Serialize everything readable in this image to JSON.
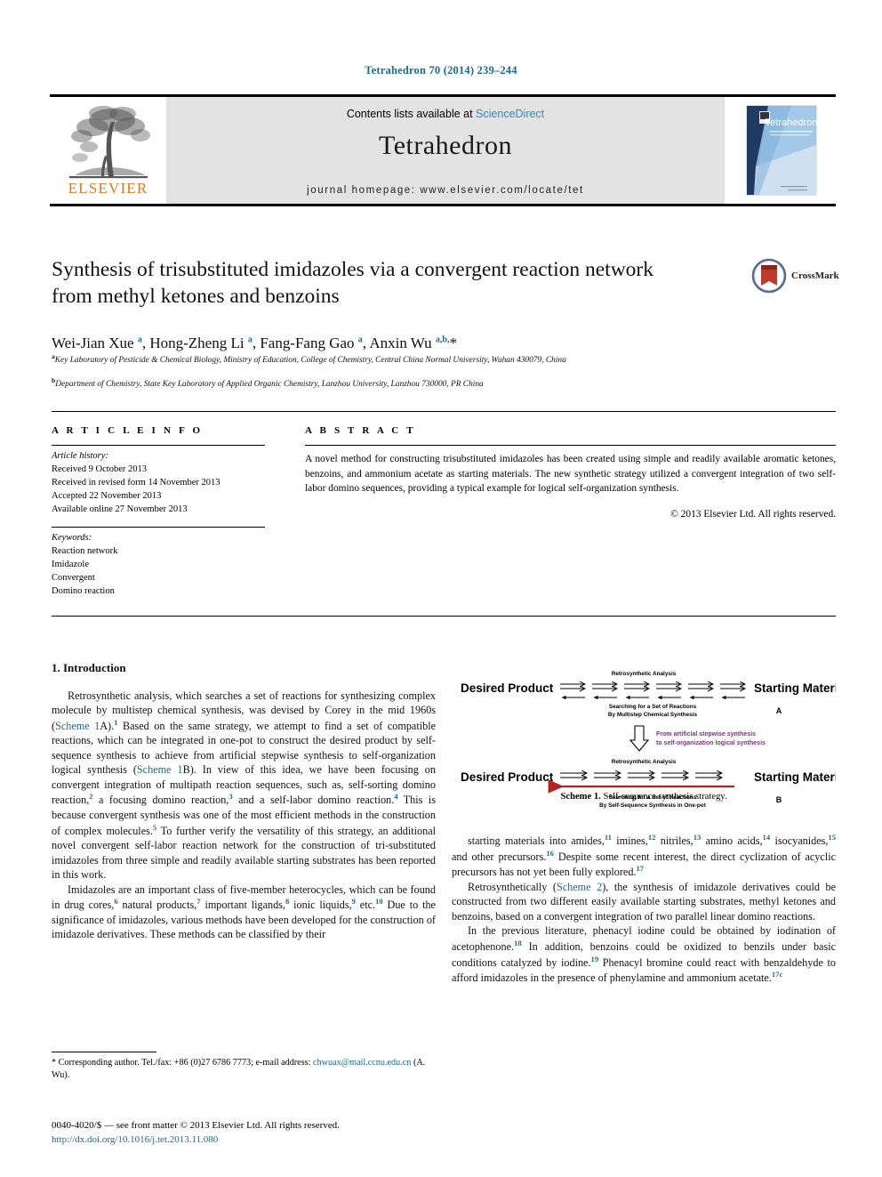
{
  "running_head": "Tetrahedron 70 (2014) 239–244",
  "masthead": {
    "publisher_logo_text": "ELSEVIER",
    "contents_prefix": "Contents lists available at ",
    "contents_link": "ScienceDirect",
    "journal_name": "Tetrahedron",
    "homepage": "journal homepage: www.elsevier.com/locate/tet",
    "cover_title": "Tetrahedron"
  },
  "article": {
    "title": "Synthesis of trisubstituted imidazoles via a convergent reaction network from methyl ketones and benzoins",
    "crossmark_label": "CrossMark",
    "authors_html": "Wei-Jian Xue <sup>a</sup>, Hong-Zheng Li <sup>a</sup>, Fang-Fang Gao <sup>a</sup>, Anxin Wu <sup>a,b,</sup>*",
    "affiliation_a": "Key Laboratory of Pesticide & Chemical Biology, Ministry of Education, College of Chemistry, Central China Normal University, Wuhan 430079, China",
    "affiliation_b": "Department of Chemistry, State Key Laboratory of Applied Organic Chemistry, Lanzhou University, Lanzhou 730000, PR China",
    "affiliation_a_marker": "a",
    "affiliation_b_marker": "b"
  },
  "info": {
    "heading": "A R T I C L E   I N F O",
    "history_label": "Article history:",
    "history": [
      "Received 9 October 2013",
      "Received in revised form 14 November 2013",
      "Accepted 22 November 2013",
      "Available online 27 November 2013"
    ],
    "keywords_label": "Keywords:",
    "keywords": [
      "Reaction network",
      "Imidazole",
      "Convergent",
      "Domino reaction"
    ]
  },
  "abstract": {
    "heading": "A B S T R A C T",
    "text": "A novel method for constructing trisubstituted imidazoles has been created using simple and readily available aromatic ketones, benzoins, and ammonium acetate as starting materials. The new synthetic strategy utilized a convergent integration of two self-labor domino sequences, providing a typical example for logical self-organization synthesis.",
    "copyright": "© 2013 Elsevier Ltd. All rights reserved."
  },
  "body": {
    "section_title": "1. Introduction",
    "left_paragraphs_html": [
      "Retrosynthetic analysis, which searches a set of reactions for synthesizing complex molecule by multistep chemical synthesis, was devised by Corey in the mid 1960s (<a class=\"xref\">Scheme 1</a>A).<sup class=\"ref\">1</sup> Based on the same strategy, we attempt to find a set of compatible reactions, which can be integrated in one-pot to construct the desired product by self-sequence synthesis to achieve from artificial stepwise synthesis to self-organization logical synthesis (<a class=\"xref\">Scheme 1</a>B). In view of this idea, we have been focusing on convergent integration of multipath reaction sequences, such as, self-sorting domino reaction,<sup class=\"ref\">2</sup> a focusing domino reaction,<sup class=\"ref\">3</sup> and a self-labor domino reaction.<sup class=\"ref\">4</sup> This is because convergent synthesis was one of the most efficient methods in the construction of complex molecules.<sup class=\"ref\">5</sup> To further verify the versatility of this strategy, an additional novel convergent self-labor reaction network for the construction of tri-substituted imidazoles from three simple and readily available starting substrates has been reported in this work.",
      "Imidazoles are an important class of five-member heterocycles, which can be found in drug cores,<sup class=\"ref\">6</sup> natural products,<sup class=\"ref\">7</sup> important ligands,<sup class=\"ref\">8</sup> ionic liquids,<sup class=\"ref\">9</sup> etc.<sup class=\"ref\">10</sup> Due to the significance of imidazoles, various methods have been developed for the construction of imidazole derivatives. These methods can be classified by their"
    ],
    "right_paragraphs_html": [
      "starting materials into amides,<sup class=\"ref\">11</sup> imines,<sup class=\"ref\">12</sup> nitriles,<sup class=\"ref\">13</sup> amino acids,<sup class=\"ref\">14</sup> isocyanides,<sup class=\"ref\">15</sup> and other precursors.<sup class=\"ref\">16</sup> Despite some recent interest, the direct cyclization of acyclic precursors has not yet been fully explored.<sup class=\"ref\">17</sup>",
      "Retrosynthetically (<a class=\"xref\">Scheme 2</a>), the synthesis of imidazole derivatives could be constructed from two different easily available starting substrates, methyl ketones and benzoins, based on a convergent integration of two parallel linear domino reactions.",
      "In the previous literature, phenacyl iodine could be obtained by iodination of acetophenone.<sup class=\"ref\">18</sup> In addition, benzoins could be oxidized to benzils under basic conditions catalyzed by iodine.<sup class=\"ref\">19</sup> Phenacyl bromine could react with benzaldehyde to afford imidazoles in the presence of phenylamine and ammonium acetate.<sup class=\"ref\">17c</sup>"
    ]
  },
  "scheme1": {
    "caption_label": "Scheme 1.",
    "caption_text": " Self-sequence synthesis strategy.",
    "top_label": "Retrosynthetic Analysis",
    "left_label": "Desired Product",
    "right_label": "Starting Materials",
    "sub_line1_a": "Searching for a Set of Reactions",
    "sub_line2_a": "By Multistep Chemical Synthesis",
    "sub_line1_b": "Searching for a Set of Reactions",
    "sub_line2_b": "By Self-Sequence Synthesis in One-pot",
    "panel_a": "A",
    "panel_b": "B",
    "transition_line1": "From artificial stepwise synthesis",
    "transition_line2": "to self-organization logical synthesis",
    "transition_color": "#8b2b8b",
    "red_arrow_color": "#b3231f"
  },
  "footer": {
    "corresponding_prefix": "* Corresponding author. Tel./fax: +86 (0)27 6786 7773; e-mail address: ",
    "email": "chwuax@mail.ccnu.edu.cn",
    "corresponding_suffix": " (A. Wu).",
    "issn_line": "0040-4020/$ — see front matter © 2013 Elsevier Ltd. All rights reserved.",
    "doi": "http://dx.doi.org/10.1016/j.tet.2013.11.080"
  },
  "colors": {
    "link_blue": "#1a6a96",
    "sciencedirect_blue": "#2b8ccc",
    "elsevier_orange": "#E87722",
    "band_gray": "#e3e3e3"
  }
}
